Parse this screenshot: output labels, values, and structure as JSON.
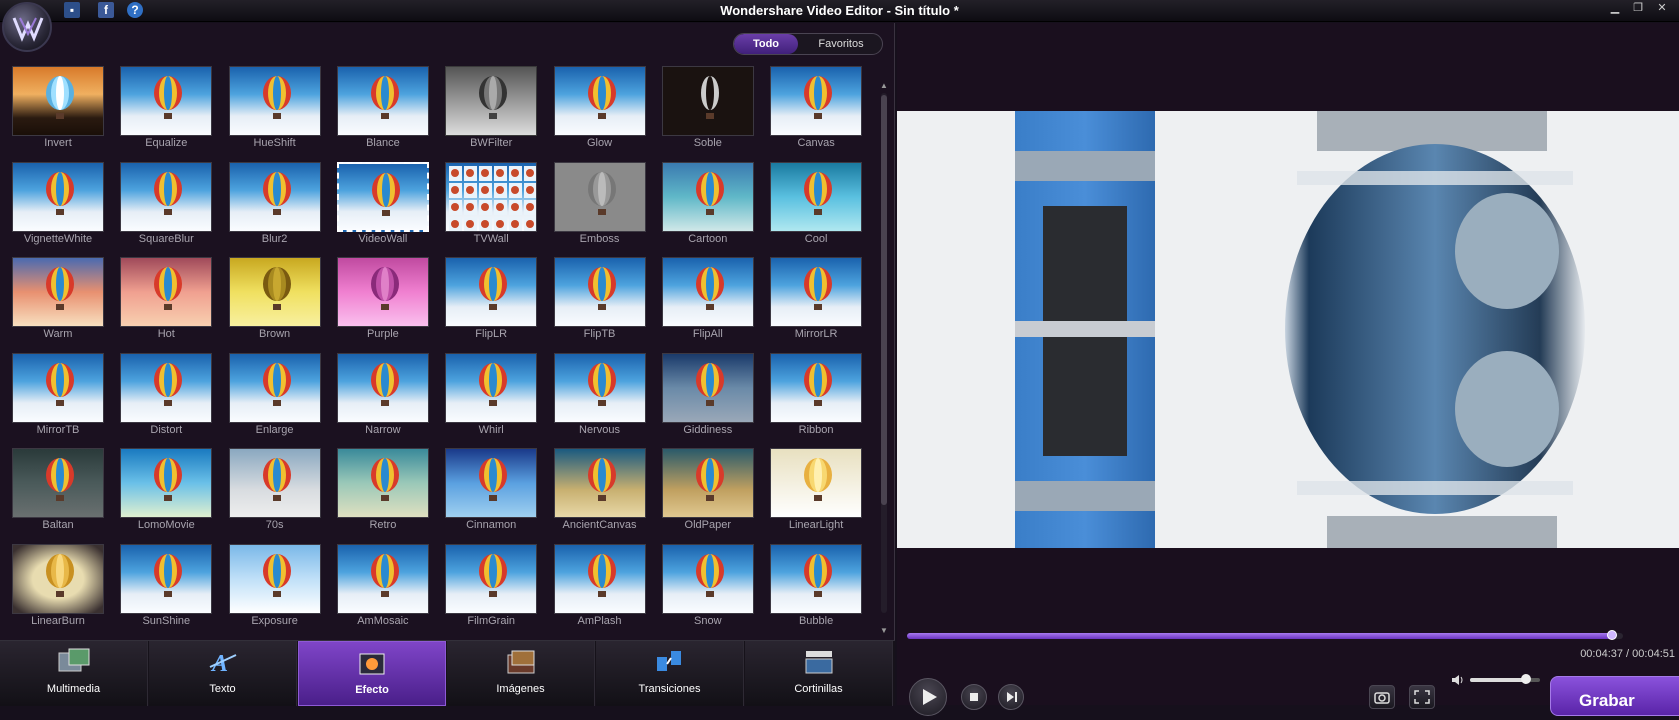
{
  "window": {
    "title": "Wondershare Video Editor - Sin título *"
  },
  "filter_tabs": {
    "all": "Todo",
    "favorites": "Favoritos"
  },
  "effects": [
    "Invert",
    "Equalize",
    "HueShift",
    "Blance",
    "BWFilter",
    "Glow",
    "Soble",
    "Canvas",
    "VignetteWhite",
    "SquareBlur",
    "Blur2",
    "VideoWall",
    "TVWall",
    "Emboss",
    "Cartoon",
    "Cool",
    "Warm",
    "Hot",
    "Brown",
    "Purple",
    "FlipLR",
    "FlipTB",
    "FlipAll",
    "MirrorLR",
    "MirrorTB",
    "Distort",
    "Enlarge",
    "Narrow",
    "Whirl",
    "Nervous",
    "Giddiness",
    "Ribbon",
    "Baltan",
    "LomoMovie",
    "70s",
    "Retro",
    "Cinnamon",
    "AncientCanvas",
    "OldPaper",
    "LinearLight",
    "LinearBurn",
    "SunShine",
    "Exposure",
    "AmMosaic",
    "FilmGrain",
    "AmPlash",
    "Snow",
    "Bubble"
  ],
  "bottom_tabs": [
    {
      "label": "Multimedia"
    },
    {
      "label": "Texto"
    },
    {
      "label": "Efecto"
    },
    {
      "label": "Imágenes"
    },
    {
      "label": "Transiciones"
    },
    {
      "label": "Cortinillas"
    }
  ],
  "active_bottom_tab": "Efecto",
  "player": {
    "time": "00:04:37 / 00:04:51",
    "progress": 0.985,
    "volume": 0.8,
    "record_label": "Grabar"
  },
  "colors": {
    "accent": "#6a33c0",
    "accent_light": "#a77af0",
    "background": "#1a0f1e"
  }
}
